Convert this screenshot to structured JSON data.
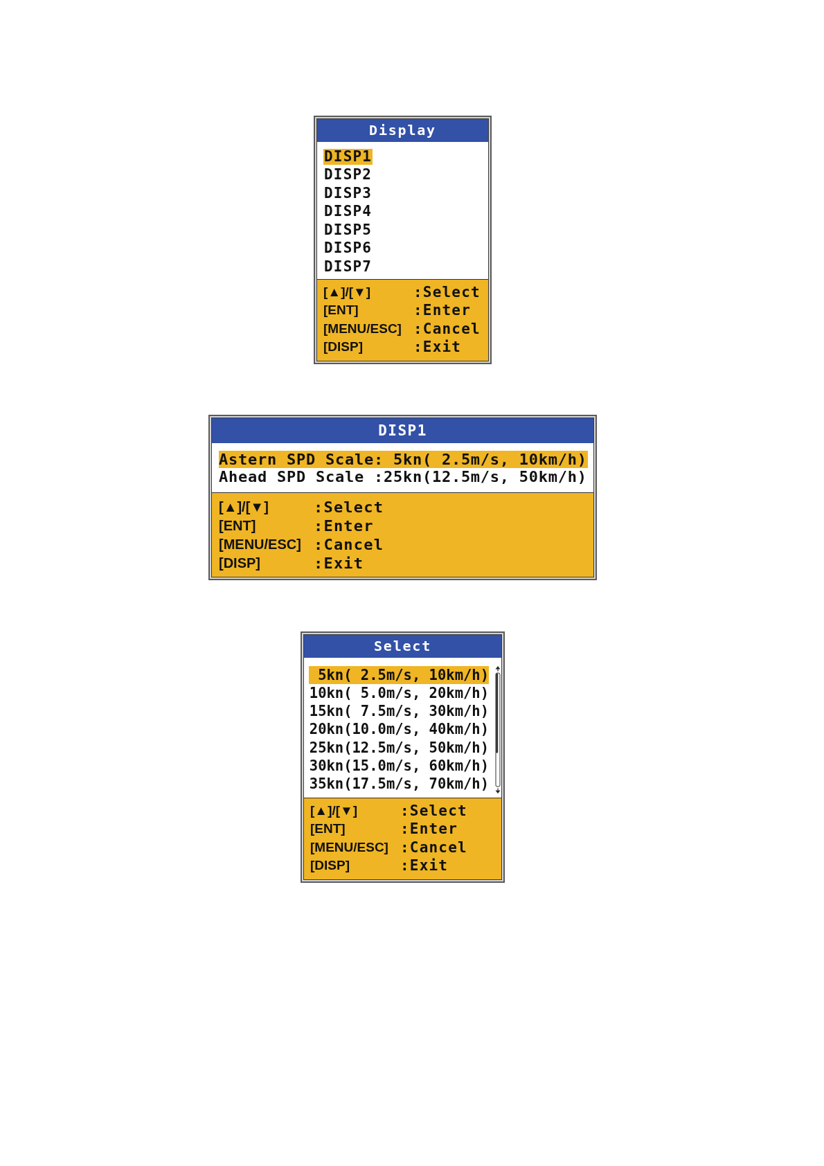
{
  "display_menu": {
    "title": "Display",
    "items": [
      {
        "label": "DISP1",
        "selected": true
      },
      {
        "label": "DISP2",
        "selected": false
      },
      {
        "label": "DISP3",
        "selected": false
      },
      {
        "label": "DISP4",
        "selected": false
      },
      {
        "label": "DISP5",
        "selected": false
      },
      {
        "label": "DISP6",
        "selected": false
      },
      {
        "label": "DISP7",
        "selected": false
      }
    ],
    "key_guide": [
      {
        "key": "[▲]/[▼]",
        "action": ":Select"
      },
      {
        "key": "[ENT]",
        "action": ":Enter"
      },
      {
        "key": "[MENU/ESC]",
        "action": ":Cancel"
      },
      {
        "key": "[DISP]",
        "action": ":Exit"
      }
    ]
  },
  "disp1_menu": {
    "title": "DISP1",
    "items": [
      {
        "label": "Astern SPD Scale: 5kn( 2.5m/s, 10km/h)",
        "selected": true
      },
      {
        "label": "Ahead SPD Scale :25kn(12.5m/s, 50km/h)",
        "selected": false
      }
    ],
    "key_guide": [
      {
        "key": "[▲]/[▼]",
        "action": ":Select"
      },
      {
        "key": "[ENT]",
        "action": ":Enter"
      },
      {
        "key": "[MENU/ESC]",
        "action": ":Cancel"
      },
      {
        "key": "[DISP]",
        "action": ":Exit"
      }
    ]
  },
  "select_menu": {
    "title": "Select",
    "options": [
      {
        "label": "5kn( 2.5m/s, 10km/h)",
        "selected": true
      },
      {
        "label": "10kn( 5.0m/s, 20km/h)",
        "selected": false
      },
      {
        "label": "15kn( 7.5m/s, 30km/h)",
        "selected": false
      },
      {
        "label": "20kn(10.0m/s, 40km/h)",
        "selected": false
      },
      {
        "label": "25kn(12.5m/s, 50km/h)",
        "selected": false
      },
      {
        "label": "30kn(15.0m/s, 60km/h)",
        "selected": false
      },
      {
        "label": "35kn(17.5m/s, 70km/h)",
        "selected": false
      }
    ],
    "key_guide": [
      {
        "key": "[▲]/[▼]",
        "action": ":Select"
      },
      {
        "key": "[ENT]",
        "action": ":Enter"
      },
      {
        "key": "[MENU/ESC]",
        "action": ":Cancel"
      },
      {
        "key": "[DISP]",
        "action": ":Exit"
      }
    ]
  }
}
